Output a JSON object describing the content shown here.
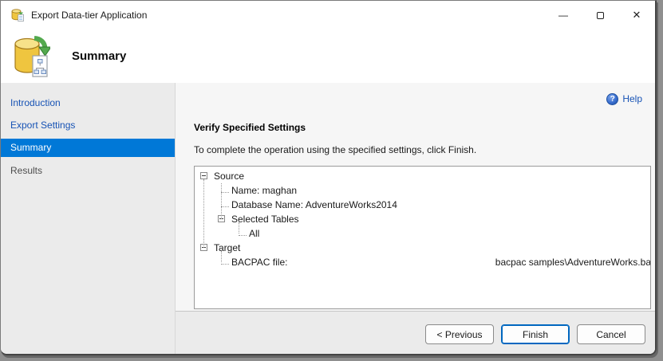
{
  "window": {
    "title": "Export Data-tier Application",
    "controls": {
      "minimize": "—",
      "close": "✕"
    }
  },
  "header": {
    "title": "Summary"
  },
  "sidebar": {
    "items": [
      {
        "label": "Introduction",
        "state": "link"
      },
      {
        "label": "Export Settings",
        "state": "link"
      },
      {
        "label": "Summary",
        "state": "selected"
      },
      {
        "label": "Results",
        "state": "pending"
      }
    ]
  },
  "main": {
    "help_label": "Help",
    "help_icon_glyph": "?",
    "heading": "Verify Specified Settings",
    "instruction": "To complete the operation using the specified settings, click Finish.",
    "tree": {
      "rows": [
        {
          "label": "Source",
          "level": 0,
          "expander": true,
          "expanded": true
        },
        {
          "label": "Name: maghan",
          "level": 1
        },
        {
          "label": "Database Name: AdventureWorks2014",
          "level": 1
        },
        {
          "label": "Selected Tables",
          "level": 1,
          "expander": true,
          "expanded": true
        },
        {
          "label": "All",
          "level": 2
        },
        {
          "label": "Target",
          "level": 0,
          "expander": true,
          "expanded": true
        },
        {
          "label": "BACPAC file:",
          "level": 1,
          "value_right": "bacpac samples\\AdventureWorks.ba"
        }
      ]
    }
  },
  "footer": {
    "buttons": [
      {
        "label": "< Previous",
        "default": false
      },
      {
        "label": "Finish",
        "default": true
      },
      {
        "label": "Cancel",
        "default": false
      }
    ]
  },
  "colors": {
    "accent_selected": "#0078d7",
    "link_blue": "#1753b5",
    "default_button_border": "#0067c0",
    "db_icon_yellow": "#efc53f",
    "arrow_green": "#53a94e"
  }
}
